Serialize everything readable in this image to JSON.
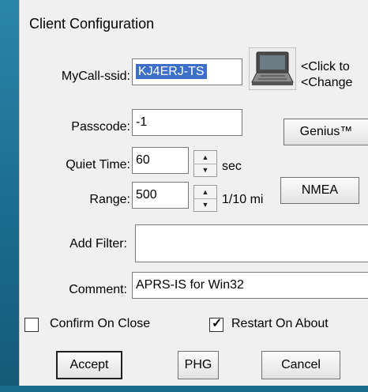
{
  "dialog": {
    "title": "Client Configuration"
  },
  "fields": {
    "mycall": {
      "label": "MyCall-ssid:",
      "value": "KJ4ERJ-TS"
    },
    "passcode": {
      "label": "Passcode:",
      "value": "-1"
    },
    "quiet_time": {
      "label": "Quiet Time:",
      "value": "60",
      "unit": "sec"
    },
    "range": {
      "label": "Range:",
      "value": "500",
      "unit": "1/10 mi"
    },
    "add_filter": {
      "label": "Add Filter:",
      "value": ""
    },
    "comment": {
      "label": "Comment:",
      "value": "APRS-IS for Win32"
    }
  },
  "laptop_hint": {
    "line1": "<Click to",
    "line2": "<Change"
  },
  "buttons": {
    "genius": "Genius™",
    "nmea": "NMEA",
    "accept": "Accept",
    "phg": "PHG",
    "cancel": "Cancel"
  },
  "checkboxes": {
    "confirm_on_close": {
      "label": "Confirm On Close",
      "checked": false
    },
    "restart_on_about": {
      "label": "Restart On About",
      "checked": true
    }
  },
  "icons": {
    "laptop": "laptop-icon",
    "spin_up": "spin-up-icon",
    "spin_down": "spin-down-icon",
    "check": "checkmark-icon"
  },
  "colors": {
    "desktop_bg": "#1f6f8f",
    "dialog_bg": "#f0f0f0",
    "selection": "#3b6fc8"
  }
}
